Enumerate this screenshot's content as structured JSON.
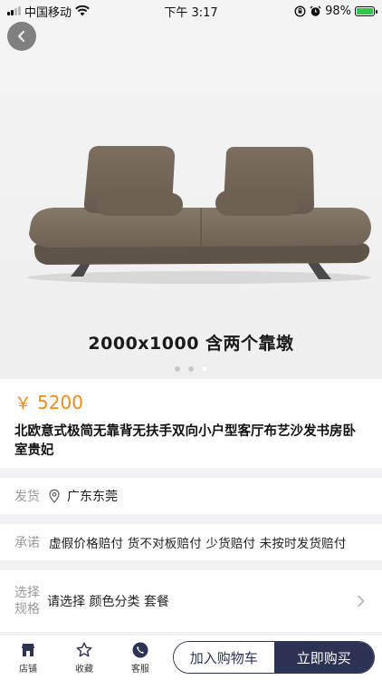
{
  "status_bar": {
    "carrier": "中国移动",
    "time": "下午 3:17",
    "battery": "98%",
    "battery_level": 0.98
  },
  "hero": {
    "caption": "2000x1000 含两个靠墩",
    "slide_count": 3,
    "active_slide": 3
  },
  "product": {
    "currency": "￥",
    "price": "5200",
    "title": "北欧意式极简无靠背无扶手双向小户型客厅布艺沙发书房卧室贵妃"
  },
  "shipping": {
    "label": "发货",
    "location": "广东东莞"
  },
  "promise": {
    "label": "承诺",
    "text": "虚假价格赔付 货不对板赔付 少货赔付 未按时发货赔付"
  },
  "spec": {
    "label_line1": "选择",
    "label_line2": "规格",
    "value": "请选择 颜色分类 套餐"
  },
  "bottom_bar": {
    "shop_label": "店铺",
    "favorite_label": "收藏",
    "service_label": "客服",
    "add_to_cart": "加入购物车",
    "buy_now": "立即购买"
  },
  "colors": {
    "price": "#f08a1a",
    "primary": "#2c3354"
  }
}
